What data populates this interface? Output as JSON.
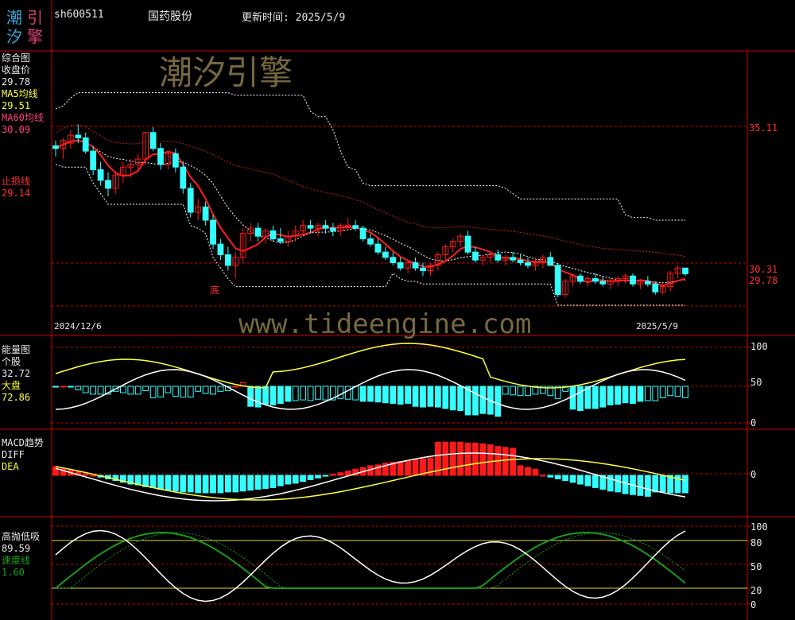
{
  "header": {
    "logo_chars": [
      "潮",
      "引",
      "汐",
      "擎"
    ],
    "code": "sh600511",
    "name": "国药股份",
    "update": "更新时间: 2025/5/9"
  },
  "watermarks": {
    "top": "潮汐引擎",
    "center": "www.tideengine.com"
  },
  "colors": {
    "up": "#ff1a1a",
    "down": "#33ffff",
    "ma60": "#ff2020",
    "yellow": "#ffff40",
    "white": "#ffffff",
    "green": "#1a9a1a",
    "axis": "#cc0000"
  },
  "panels": {
    "main": {
      "title": "综合图",
      "close_label": "收盘价",
      "close_value": "29.78",
      "ma5_label": "MA5均线",
      "ma5_value": "29.51",
      "ma60_label": "MA60均线",
      "ma60_value": "30.09",
      "stop_label": "止损线",
      "stop_value": "29.14",
      "marker": "底",
      "date_start": "2024/12/6",
      "date_end": "2025/5/9",
      "axis_labels": [
        "35.11",
        "30.31",
        "29.78"
      ]
    },
    "energy": {
      "title": "能量图",
      "stock_label": "个股",
      "stock_value": "32.72",
      "market_label": "大盘",
      "market_value": "72.86",
      "axis_labels": [
        "100",
        "50",
        "0"
      ]
    },
    "macd": {
      "title": "MACD趋势",
      "diff_label": "DIFF",
      "dea_label": "DEA",
      "axis_labels": [
        "0"
      ]
    },
    "hilo": {
      "title": "高抛低吸",
      "value": "89.59",
      "speed_label": "速度线",
      "speed_value": "1.60",
      "axis_labels": [
        "100",
        "80",
        "50",
        "20",
        "0"
      ]
    }
  },
  "chart_data": {
    "type": "candlestick",
    "title": "国药股份",
    "x_range": [
      "2024/12/6",
      "2025/5/9"
    ],
    "candles": [
      [
        34.6,
        34.8,
        34.2,
        34.5
      ],
      [
        34.5,
        34.9,
        34.1,
        34.8
      ],
      [
        34.7,
        35.2,
        34.5,
        35.0
      ],
      [
        35.0,
        35.4,
        34.7,
        34.9
      ],
      [
        34.9,
        35.1,
        34.3,
        34.4
      ],
      [
        34.4,
        34.6,
        33.5,
        33.7
      ],
      [
        33.7,
        34.0,
        33.1,
        33.3
      ],
      [
        33.3,
        33.6,
        32.7,
        33.0
      ],
      [
        33.0,
        33.6,
        32.8,
        33.5
      ],
      [
        33.5,
        34.0,
        33.2,
        33.8
      ],
      [
        33.8,
        34.1,
        33.4,
        33.9
      ],
      [
        33.9,
        34.3,
        33.6,
        34.1
      ],
      [
        34.1,
        35.1,
        33.9,
        35.1
      ],
      [
        35.1,
        35.3,
        34.4,
        34.5
      ],
      [
        34.5,
        34.7,
        33.7,
        33.9
      ],
      [
        33.9,
        34.4,
        33.7,
        34.3
      ],
      [
        34.3,
        34.5,
        33.6,
        33.8
      ],
      [
        33.8,
        34.0,
        32.8,
        33.0
      ],
      [
        33.0,
        33.2,
        31.9,
        32.1
      ],
      [
        32.1,
        32.6,
        31.8,
        32.3
      ],
      [
        32.3,
        32.5,
        31.6,
        31.8
      ],
      [
        31.8,
        32.0,
        30.7,
        30.9
      ],
      [
        30.9,
        31.1,
        30.3,
        30.5
      ],
      [
        30.5,
        30.8,
        29.9,
        30.1
      ],
      [
        30.1,
        30.6,
        29.6,
        30.4
      ],
      [
        30.4,
        31.5,
        30.2,
        31.3
      ],
      [
        31.3,
        31.7,
        31.0,
        31.5
      ],
      [
        31.5,
        31.7,
        31.0,
        31.2
      ],
      [
        31.2,
        31.5,
        30.9,
        31.4
      ],
      [
        31.4,
        31.6,
        31.0,
        31.1
      ],
      [
        31.1,
        31.5,
        30.9,
        31.0
      ],
      [
        31.0,
        31.4,
        30.8,
        31.2
      ],
      [
        31.2,
        31.6,
        31.0,
        31.4
      ],
      [
        31.4,
        31.8,
        31.2,
        31.6
      ],
      [
        31.6,
        31.8,
        31.3,
        31.5
      ],
      [
        31.5,
        31.7,
        31.2,
        31.6
      ],
      [
        31.6,
        31.8,
        31.3,
        31.5
      ],
      [
        31.5,
        31.7,
        31.2,
        31.4
      ],
      [
        31.4,
        31.7,
        31.2,
        31.6
      ],
      [
        31.6,
        31.9,
        31.4,
        31.6
      ],
      [
        31.6,
        31.8,
        31.4,
        31.5
      ],
      [
        31.5,
        31.6,
        31.0,
        31.1
      ],
      [
        31.1,
        31.3,
        30.8,
        30.9
      ],
      [
        30.9,
        31.1,
        30.5,
        30.6
      ],
      [
        30.6,
        30.8,
        30.3,
        30.4
      ],
      [
        30.4,
        30.6,
        30.1,
        30.2
      ],
      [
        30.2,
        30.4,
        29.9,
        30.0
      ],
      [
        30.0,
        30.3,
        29.8,
        30.2
      ],
      [
        30.2,
        30.4,
        29.9,
        30.0
      ],
      [
        30.0,
        30.2,
        29.7,
        29.9
      ],
      [
        29.9,
        30.2,
        29.7,
        30.1
      ],
      [
        30.1,
        30.6,
        29.9,
        30.5
      ],
      [
        30.5,
        30.9,
        30.3,
        30.8
      ],
      [
        30.8,
        31.1,
        30.6,
        31.0
      ],
      [
        31.0,
        31.3,
        30.8,
        31.2
      ],
      [
        31.2,
        31.4,
        30.5,
        30.6
      ],
      [
        30.6,
        30.8,
        30.2,
        30.3
      ],
      [
        30.3,
        30.5,
        30.1,
        30.4
      ],
      [
        30.4,
        30.6,
        30.2,
        30.5
      ],
      [
        30.5,
        30.7,
        30.2,
        30.3
      ],
      [
        30.3,
        30.5,
        30.1,
        30.4
      ],
      [
        30.4,
        30.6,
        30.2,
        30.3
      ],
      [
        30.3,
        30.5,
        30.1,
        30.2
      ],
      [
        30.2,
        30.4,
        30.0,
        30.1
      ],
      [
        30.1,
        30.4,
        29.9,
        30.2
      ],
      [
        30.2,
        30.5,
        30.0,
        30.4
      ],
      [
        30.4,
        30.6,
        30.1,
        30.1
      ],
      [
        30.1,
        30.2,
        28.9,
        29.0
      ],
      [
        29.0,
        29.6,
        28.9,
        29.5
      ],
      [
        29.5,
        29.8,
        29.3,
        29.7
      ],
      [
        29.7,
        29.8,
        29.4,
        29.5
      ],
      [
        29.5,
        29.7,
        29.3,
        29.6
      ],
      [
        29.6,
        29.8,
        29.4,
        29.5
      ],
      [
        29.5,
        29.7,
        29.3,
        29.4
      ],
      [
        29.4,
        29.6,
        29.2,
        29.5
      ],
      [
        29.5,
        29.7,
        29.3,
        29.6
      ],
      [
        29.6,
        29.8,
        29.4,
        29.7
      ],
      [
        29.7,
        29.8,
        29.3,
        29.4
      ],
      [
        29.4,
        29.6,
        29.2,
        29.5
      ],
      [
        29.5,
        29.7,
        29.3,
        29.4
      ],
      [
        29.4,
        29.5,
        29.0,
        29.1
      ],
      [
        29.1,
        29.4,
        29.0,
        29.3
      ],
      [
        29.3,
        29.9,
        29.1,
        29.8
      ],
      [
        29.8,
        30.1,
        29.6,
        30.0
      ],
      [
        30.0,
        30.0,
        29.7,
        29.78
      ]
    ]
  }
}
